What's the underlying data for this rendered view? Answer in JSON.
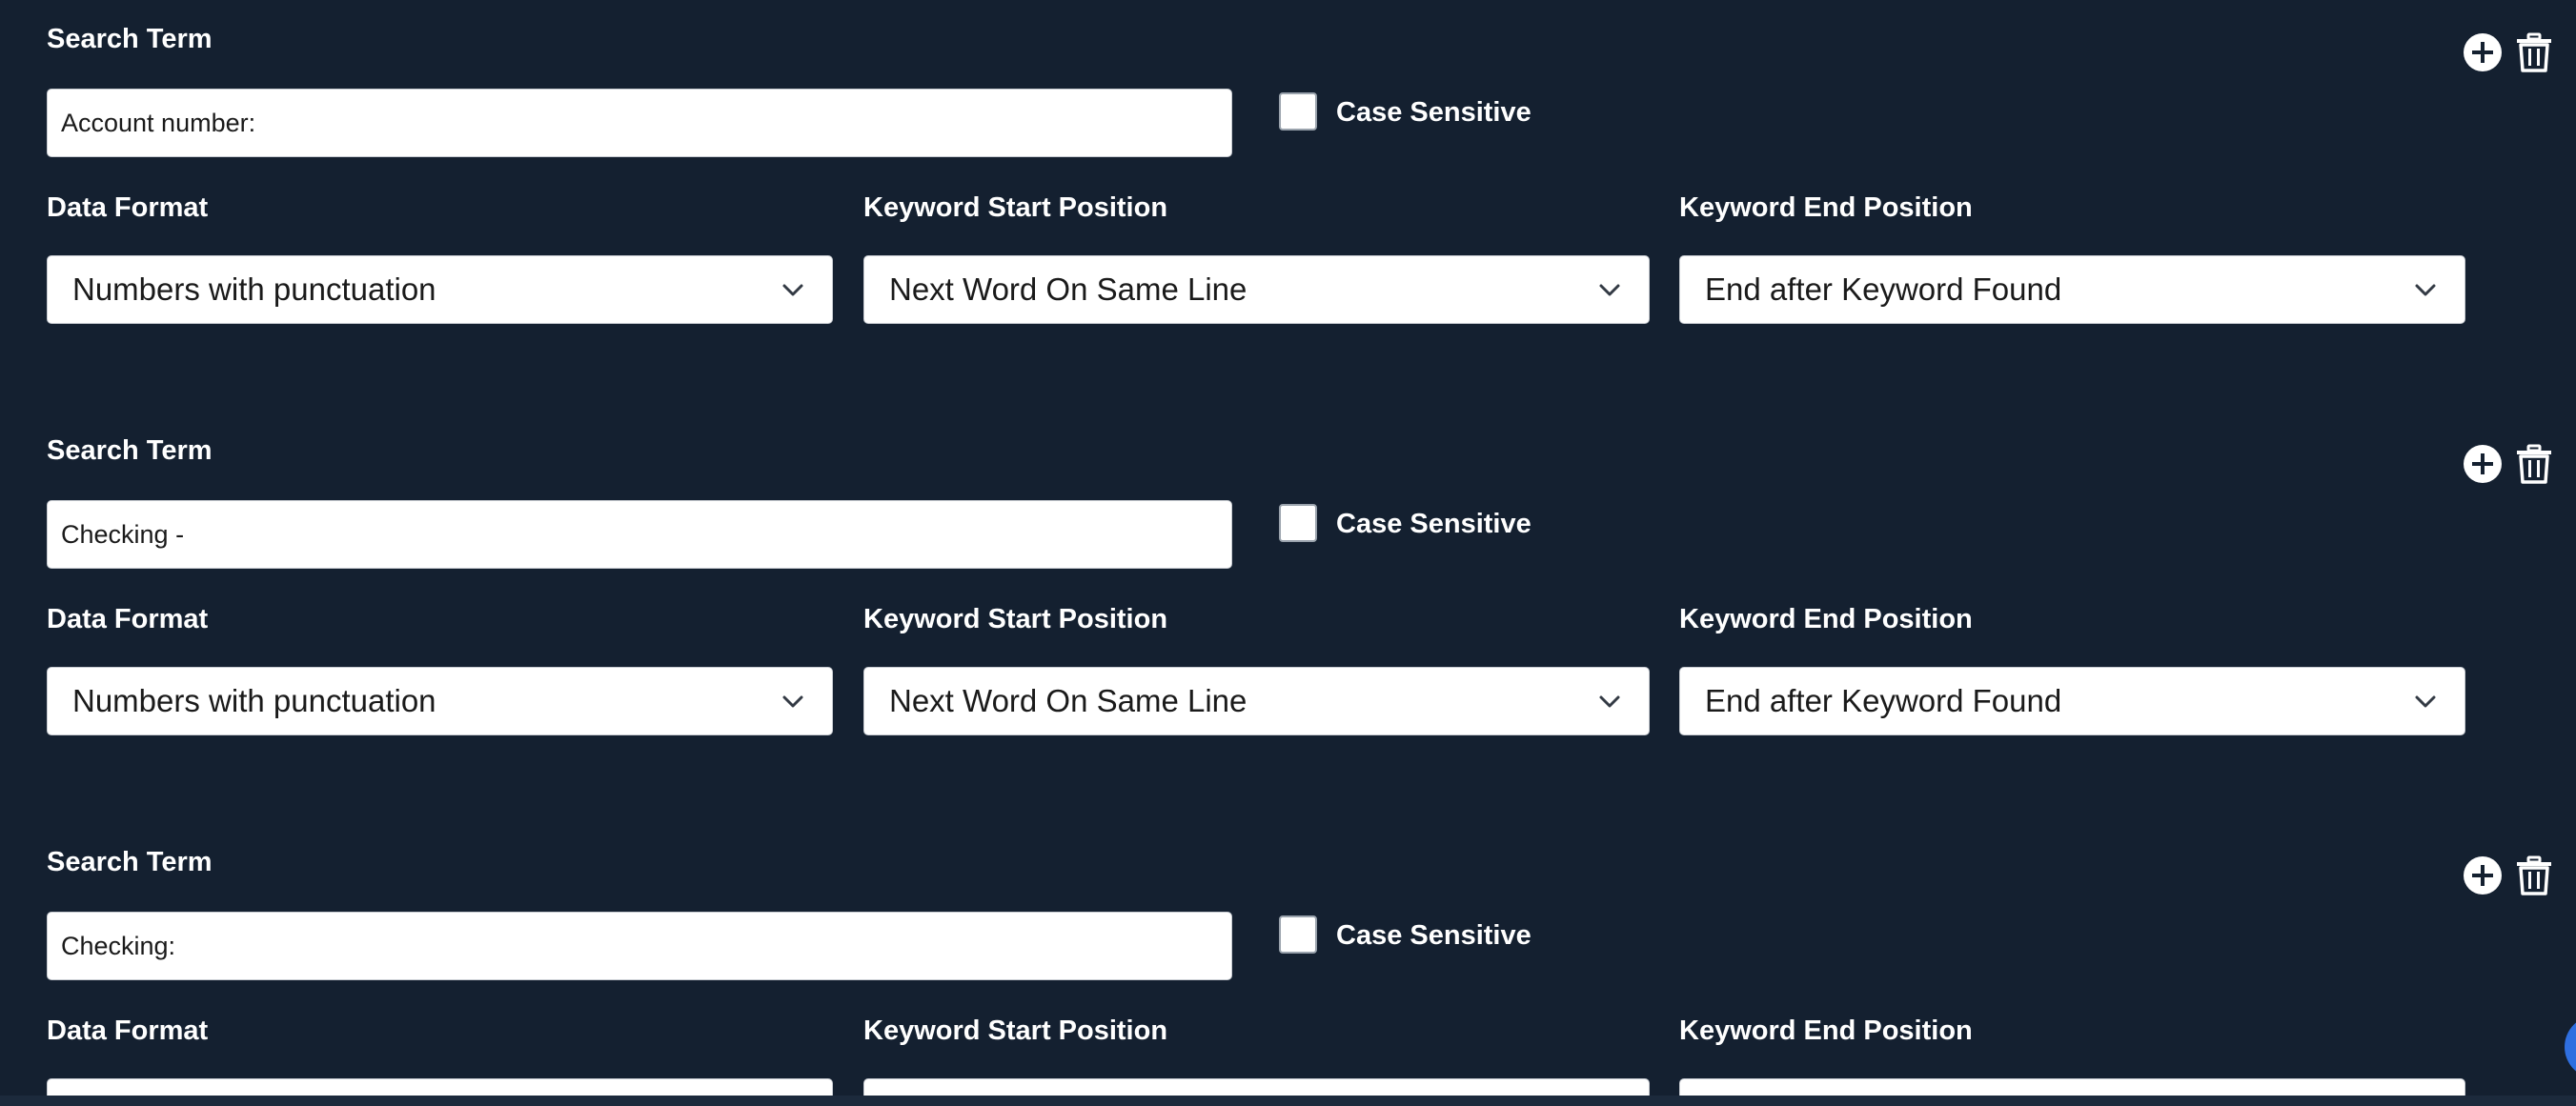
{
  "labels": {
    "search_term": "Search Term",
    "case_sensitive": "Case Sensitive",
    "data_format": "Data Format",
    "keyword_start_position": "Keyword Start Position",
    "keyword_end_position": "Keyword End Position"
  },
  "icons": {
    "add": "plus-circle-icon",
    "delete": "trash-icon",
    "dropdown": "chevron-down-icon"
  },
  "colors": {
    "background": "#142030",
    "accent": "#2f6fe0"
  },
  "rules": [
    {
      "search_term": "Account number:",
      "case_sensitive": false,
      "data_format": "Numbers with punctuation",
      "keyword_start_position": "Next Word On Same Line",
      "keyword_end_position": "End after Keyword Found"
    },
    {
      "search_term": "Checking -",
      "case_sensitive": false,
      "data_format": "Numbers with punctuation",
      "keyword_start_position": "Next Word On Same Line",
      "keyword_end_position": "End after Keyword Found"
    },
    {
      "search_term": "Checking:",
      "case_sensitive": false,
      "data_format": "",
      "keyword_start_position": "",
      "keyword_end_position": ""
    }
  ]
}
